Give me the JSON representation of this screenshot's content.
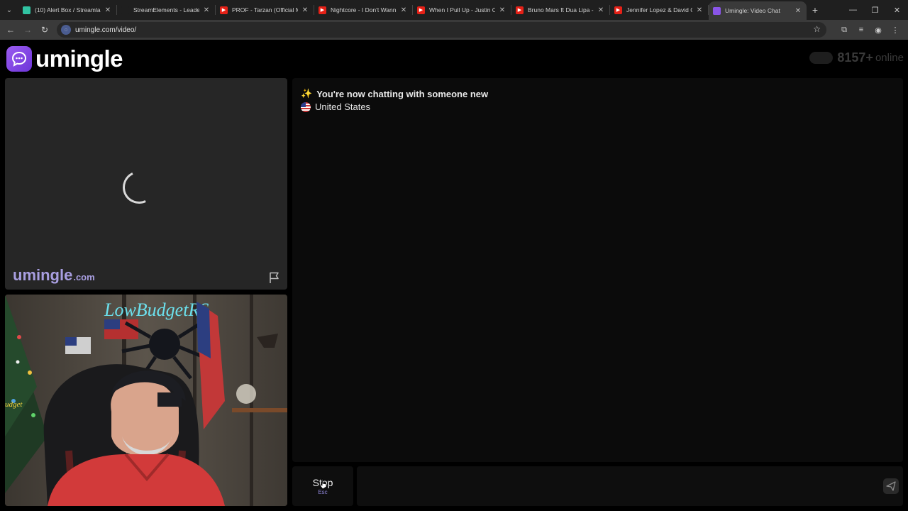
{
  "browser": {
    "tabs": [
      {
        "title": "(10) Alert Box / Streamlab",
        "favicon": "streamlabs-icon",
        "color": "#31c3a2"
      },
      {
        "title": "StreamElements - Leaderb",
        "favicon": "streamelements-icon",
        "color": "#1f1f1f"
      },
      {
        "title": "PROF - Tarzan (Official Mu",
        "favicon": "youtube-icon",
        "color": "#e62117"
      },
      {
        "title": "Nightcore - I Don't Wanna",
        "favicon": "youtube-icon",
        "color": "#e62117"
      },
      {
        "title": "When I Pull Up - Justin Ch",
        "favicon": "youtube-icon",
        "color": "#e62117"
      },
      {
        "title": "Bruno Mars ft Dua Lipa -",
        "favicon": "youtube-icon",
        "color": "#e62117"
      },
      {
        "title": "Jennifer Lopez & David G",
        "favicon": "youtube-icon",
        "color": "#e62117"
      },
      {
        "title": "Umingle: Video Chat",
        "favicon": "umingle-icon",
        "color": "#8a55e8",
        "active": true
      }
    ],
    "url": "umingle.com/video/"
  },
  "header": {
    "logo_text": "umingle",
    "online_count": "8157+",
    "online_label": "online"
  },
  "stranger": {
    "watermark_main": "umingle",
    "watermark_tld": ".com"
  },
  "chat": {
    "status_message": "You're now chatting with someone new",
    "country": "United States"
  },
  "controls": {
    "stop_label": "Stop",
    "stop_key": "Esc"
  },
  "colors": {
    "brand": "#8a55e8",
    "watermark": "#a89ee0"
  }
}
